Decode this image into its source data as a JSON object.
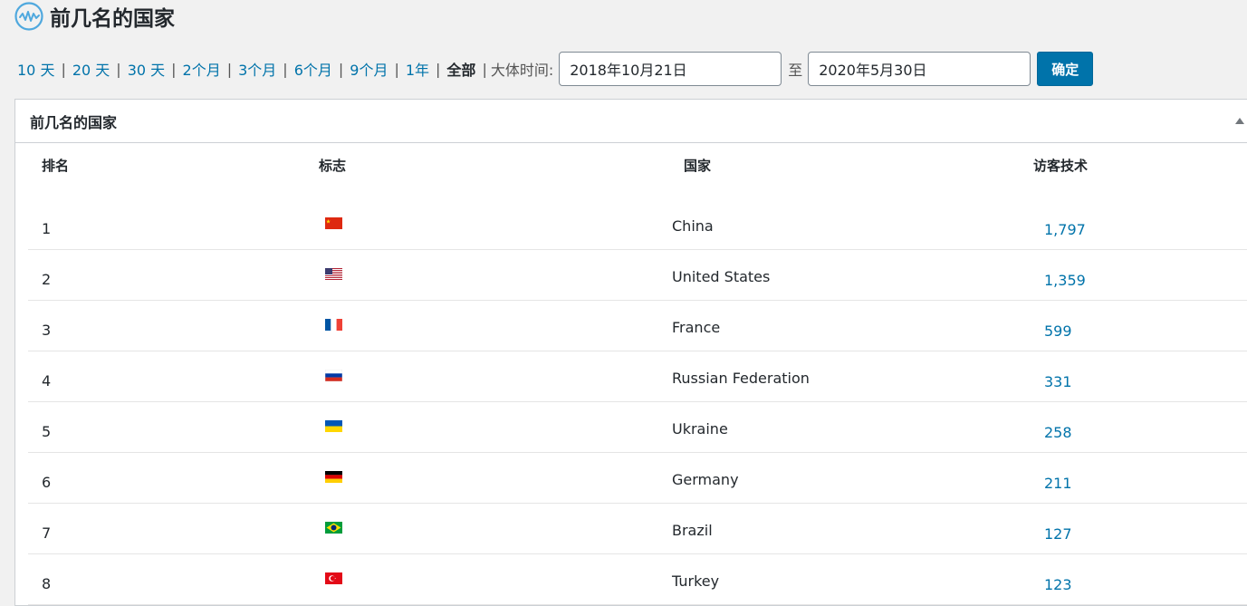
{
  "header": {
    "logo_icon": "stats-wave-icon",
    "title": "前几名的国家"
  },
  "filters": {
    "links": [
      "10 天",
      "20 天",
      "30 天",
      "2个月",
      "3个月",
      "6个月",
      "9个月",
      "1年"
    ],
    "active": "全部",
    "range_label": "大体时间:",
    "from_date": "2018年10月21日",
    "to_label": "至",
    "to_date": "2020年5月30日",
    "confirm_label": "确定",
    "accent_color": "#0073aa"
  },
  "panel": {
    "title": "前几名的国家",
    "toggle_icon": "triangle-up-icon",
    "columns": [
      "排名",
      "标志",
      "国家",
      "访客技术"
    ],
    "rows": [
      {
        "rank": "1",
        "flag": "cn-flag-icon",
        "country": "China",
        "visits": "1,797"
      },
      {
        "rank": "2",
        "flag": "us-flag-icon",
        "country": "United States",
        "visits": "1,359"
      },
      {
        "rank": "3",
        "flag": "fr-flag-icon",
        "country": "France",
        "visits": "599"
      },
      {
        "rank": "4",
        "flag": "ru-flag-icon",
        "country": "Russian Federation",
        "visits": "331"
      },
      {
        "rank": "5",
        "flag": "ua-flag-icon",
        "country": "Ukraine",
        "visits": "258"
      },
      {
        "rank": "6",
        "flag": "de-flag-icon",
        "country": "Germany",
        "visits": "211"
      },
      {
        "rank": "7",
        "flag": "br-flag-icon",
        "country": "Brazil",
        "visits": "127"
      },
      {
        "rank": "8",
        "flag": "tr-flag-icon",
        "country": "Turkey",
        "visits": "123"
      }
    ]
  }
}
